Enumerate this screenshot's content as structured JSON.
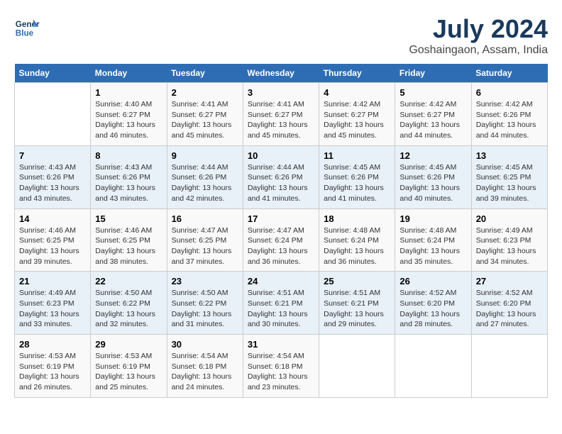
{
  "header": {
    "logo_line1": "General",
    "logo_line2": "Blue",
    "month_year": "July 2024",
    "location": "Goshaingaon, Assam, India"
  },
  "days_of_week": [
    "Sunday",
    "Monday",
    "Tuesday",
    "Wednesday",
    "Thursday",
    "Friday",
    "Saturday"
  ],
  "weeks": [
    [
      {
        "day": "",
        "info": ""
      },
      {
        "day": "1",
        "info": "Sunrise: 4:40 AM\nSunset: 6:27 PM\nDaylight: 13 hours\nand 46 minutes."
      },
      {
        "day": "2",
        "info": "Sunrise: 4:41 AM\nSunset: 6:27 PM\nDaylight: 13 hours\nand 45 minutes."
      },
      {
        "day": "3",
        "info": "Sunrise: 4:41 AM\nSunset: 6:27 PM\nDaylight: 13 hours\nand 45 minutes."
      },
      {
        "day": "4",
        "info": "Sunrise: 4:42 AM\nSunset: 6:27 PM\nDaylight: 13 hours\nand 45 minutes."
      },
      {
        "day": "5",
        "info": "Sunrise: 4:42 AM\nSunset: 6:27 PM\nDaylight: 13 hours\nand 44 minutes."
      },
      {
        "day": "6",
        "info": "Sunrise: 4:42 AM\nSunset: 6:26 PM\nDaylight: 13 hours\nand 44 minutes."
      }
    ],
    [
      {
        "day": "7",
        "info": "Sunrise: 4:43 AM\nSunset: 6:26 PM\nDaylight: 13 hours\nand 43 minutes."
      },
      {
        "day": "8",
        "info": "Sunrise: 4:43 AM\nSunset: 6:26 PM\nDaylight: 13 hours\nand 43 minutes."
      },
      {
        "day": "9",
        "info": "Sunrise: 4:44 AM\nSunset: 6:26 PM\nDaylight: 13 hours\nand 42 minutes."
      },
      {
        "day": "10",
        "info": "Sunrise: 4:44 AM\nSunset: 6:26 PM\nDaylight: 13 hours\nand 41 minutes."
      },
      {
        "day": "11",
        "info": "Sunrise: 4:45 AM\nSunset: 6:26 PM\nDaylight: 13 hours\nand 41 minutes."
      },
      {
        "day": "12",
        "info": "Sunrise: 4:45 AM\nSunset: 6:26 PM\nDaylight: 13 hours\nand 40 minutes."
      },
      {
        "day": "13",
        "info": "Sunrise: 4:45 AM\nSunset: 6:25 PM\nDaylight: 13 hours\nand 39 minutes."
      }
    ],
    [
      {
        "day": "14",
        "info": "Sunrise: 4:46 AM\nSunset: 6:25 PM\nDaylight: 13 hours\nand 39 minutes."
      },
      {
        "day": "15",
        "info": "Sunrise: 4:46 AM\nSunset: 6:25 PM\nDaylight: 13 hours\nand 38 minutes."
      },
      {
        "day": "16",
        "info": "Sunrise: 4:47 AM\nSunset: 6:25 PM\nDaylight: 13 hours\nand 37 minutes."
      },
      {
        "day": "17",
        "info": "Sunrise: 4:47 AM\nSunset: 6:24 PM\nDaylight: 13 hours\nand 36 minutes."
      },
      {
        "day": "18",
        "info": "Sunrise: 4:48 AM\nSunset: 6:24 PM\nDaylight: 13 hours\nand 36 minutes."
      },
      {
        "day": "19",
        "info": "Sunrise: 4:48 AM\nSunset: 6:24 PM\nDaylight: 13 hours\nand 35 minutes."
      },
      {
        "day": "20",
        "info": "Sunrise: 4:49 AM\nSunset: 6:23 PM\nDaylight: 13 hours\nand 34 minutes."
      }
    ],
    [
      {
        "day": "21",
        "info": "Sunrise: 4:49 AM\nSunset: 6:23 PM\nDaylight: 13 hours\nand 33 minutes."
      },
      {
        "day": "22",
        "info": "Sunrise: 4:50 AM\nSunset: 6:22 PM\nDaylight: 13 hours\nand 32 minutes."
      },
      {
        "day": "23",
        "info": "Sunrise: 4:50 AM\nSunset: 6:22 PM\nDaylight: 13 hours\nand 31 minutes."
      },
      {
        "day": "24",
        "info": "Sunrise: 4:51 AM\nSunset: 6:21 PM\nDaylight: 13 hours\nand 30 minutes."
      },
      {
        "day": "25",
        "info": "Sunrise: 4:51 AM\nSunset: 6:21 PM\nDaylight: 13 hours\nand 29 minutes."
      },
      {
        "day": "26",
        "info": "Sunrise: 4:52 AM\nSunset: 6:20 PM\nDaylight: 13 hours\nand 28 minutes."
      },
      {
        "day": "27",
        "info": "Sunrise: 4:52 AM\nSunset: 6:20 PM\nDaylight: 13 hours\nand 27 minutes."
      }
    ],
    [
      {
        "day": "28",
        "info": "Sunrise: 4:53 AM\nSunset: 6:19 PM\nDaylight: 13 hours\nand 26 minutes."
      },
      {
        "day": "29",
        "info": "Sunrise: 4:53 AM\nSunset: 6:19 PM\nDaylight: 13 hours\nand 25 minutes."
      },
      {
        "day": "30",
        "info": "Sunrise: 4:54 AM\nSunset: 6:18 PM\nDaylight: 13 hours\nand 24 minutes."
      },
      {
        "day": "31",
        "info": "Sunrise: 4:54 AM\nSunset: 6:18 PM\nDaylight: 13 hours\nand 23 minutes."
      },
      {
        "day": "",
        "info": ""
      },
      {
        "day": "",
        "info": ""
      },
      {
        "day": "",
        "info": ""
      }
    ]
  ]
}
